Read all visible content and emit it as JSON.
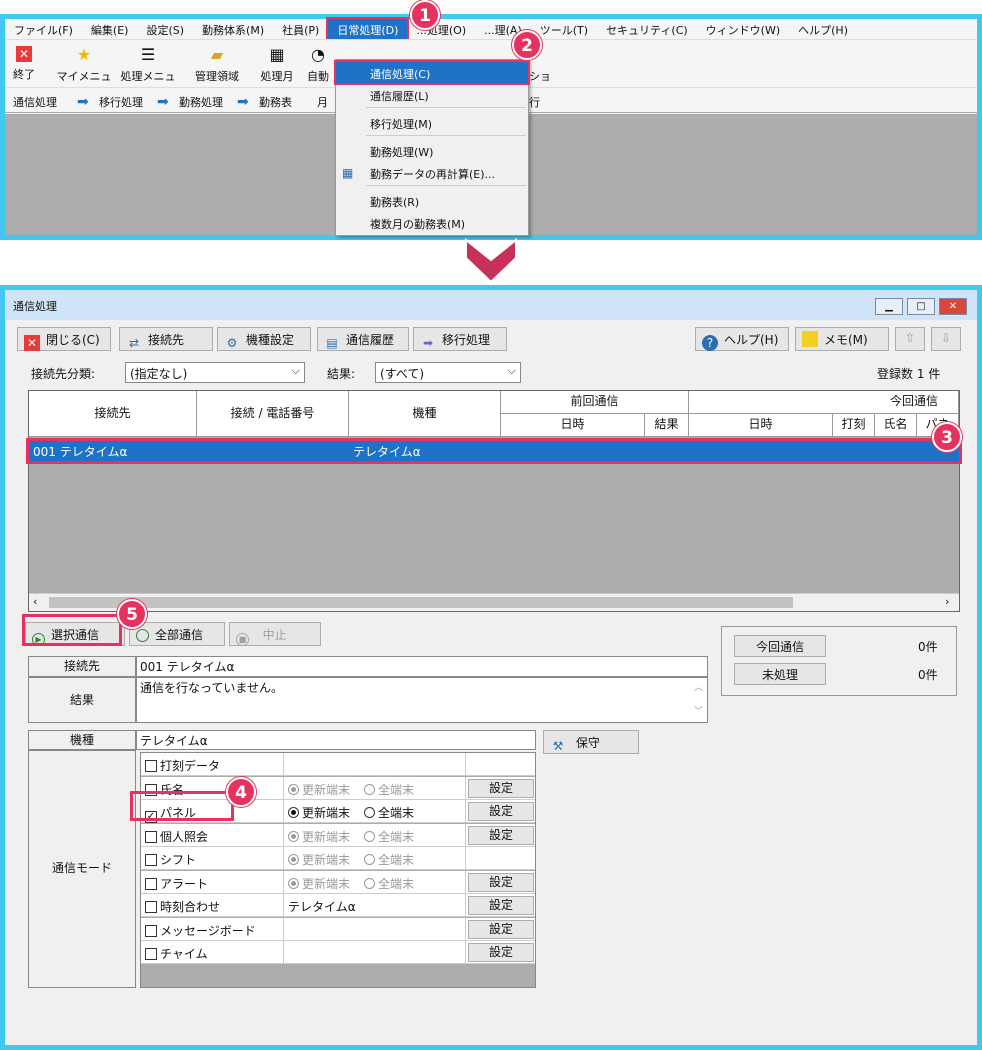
{
  "top": {
    "menubar": [
      "ファイル(F)",
      "編集(E)",
      "設定(S)",
      "勤務体系(M)",
      "社員(P)",
      "日常処理(D)",
      "...処理(O)",
      "...理(A)",
      "ツール(T)",
      "セキュリティ(C)",
      "ウィンドウ(W)",
      "ヘルプ(H)"
    ],
    "toolbar": {
      "exit": "終了",
      "my_menu": "マイメニュー",
      "proc_menu": "処理メニュー",
      "manage_area": "管理領域",
      "proc_month": "処理月",
      "auto": "自動",
      "option_tail": "ション"
    },
    "flow": [
      "通信処理",
      "移行処理",
      "勤務処理",
      "勤務表"
    ],
    "flow_tail": "月",
    "flow_tail2": "行",
    "dropdown": {
      "items": [
        "通信処理(C)",
        "通信履歴(L)",
        "移行処理(M)",
        "勤務処理(W)",
        "勤務データの再計算(E)...",
        "勤務表(R)",
        "複数月の勤務表(M)"
      ]
    }
  },
  "badges": [
    "1",
    "2",
    "3",
    "4",
    "5"
  ],
  "window": {
    "title": "通信処理",
    "buttons": {
      "close": "閉じる(C)",
      "connect": "接続先",
      "model": "機種設定",
      "history": "通信履歴",
      "migrate": "移行処理",
      "help": "ヘルプ(H)",
      "memo": "メモ(M)"
    },
    "filter": {
      "category_label": "接続先分類:",
      "category_value": "(指定なし)",
      "result_label": "結果:",
      "result_value": "(すべて)",
      "count_label": "登録数",
      "count_value": "1",
      "count_unit": "件"
    },
    "grid": {
      "headers": {
        "dest": "接続先",
        "conn": "接続 / 電話番号",
        "model": "機種",
        "prev": "前回通信",
        "prev_dt": "日時",
        "prev_res": "結果",
        "cur": "今回通信",
        "cur_dt": "日時",
        "cur_stamp": "打刻",
        "cur_name": "氏名",
        "cur_panel": "パネ"
      },
      "rows": [
        {
          "dest": "001 テレタイムα",
          "conn": "",
          "model": "テレタイムα"
        }
      ]
    },
    "actions": {
      "select": "選択通信",
      "all": "全部通信",
      "stop": "中止"
    },
    "summary": {
      "current_label": "今回通信",
      "current_value": "0件",
      "unprocessed_label": "未処理",
      "unprocessed_value": "0件"
    },
    "detail": {
      "dest_label": "接続先",
      "dest_value": "001 テレタイムα",
      "result_label": "結果",
      "result_value": "通信を行なっていません。",
      "model_label": "機種",
      "model_value": "テレタイムα",
      "maintain": "保守",
      "mode_label": "通信モード"
    },
    "modes": [
      {
        "name": "打刻データ",
        "checked": false,
        "opt": "none",
        "setting": false
      },
      {
        "name": "氏名",
        "checked": false,
        "opt": "dim",
        "setting": true
      },
      {
        "name": "パネル",
        "checked": true,
        "opt": "active",
        "setting": true
      },
      {
        "name": "個人照会",
        "checked": false,
        "opt": "dim",
        "setting": true
      },
      {
        "name": "シフト",
        "checked": false,
        "opt": "dim",
        "setting": false
      },
      {
        "name": "アラート",
        "checked": false,
        "opt": "dim",
        "setting": true
      },
      {
        "name": "時刻合わせ",
        "checked": false,
        "opt": "text",
        "text": "テレタイムα",
        "setting": true
      },
      {
        "name": "メッセージボード",
        "checked": false,
        "opt": "none",
        "setting": true
      },
      {
        "name": "チャイム",
        "checked": false,
        "opt": "none",
        "setting": true
      }
    ],
    "mode_opts": {
      "update": "更新端末",
      "all": "全端末",
      "setting": "設定"
    }
  },
  "colors": {
    "accent": "#41c8ee",
    "highlight": "#e5325e",
    "selection": "#1e73c8"
  }
}
